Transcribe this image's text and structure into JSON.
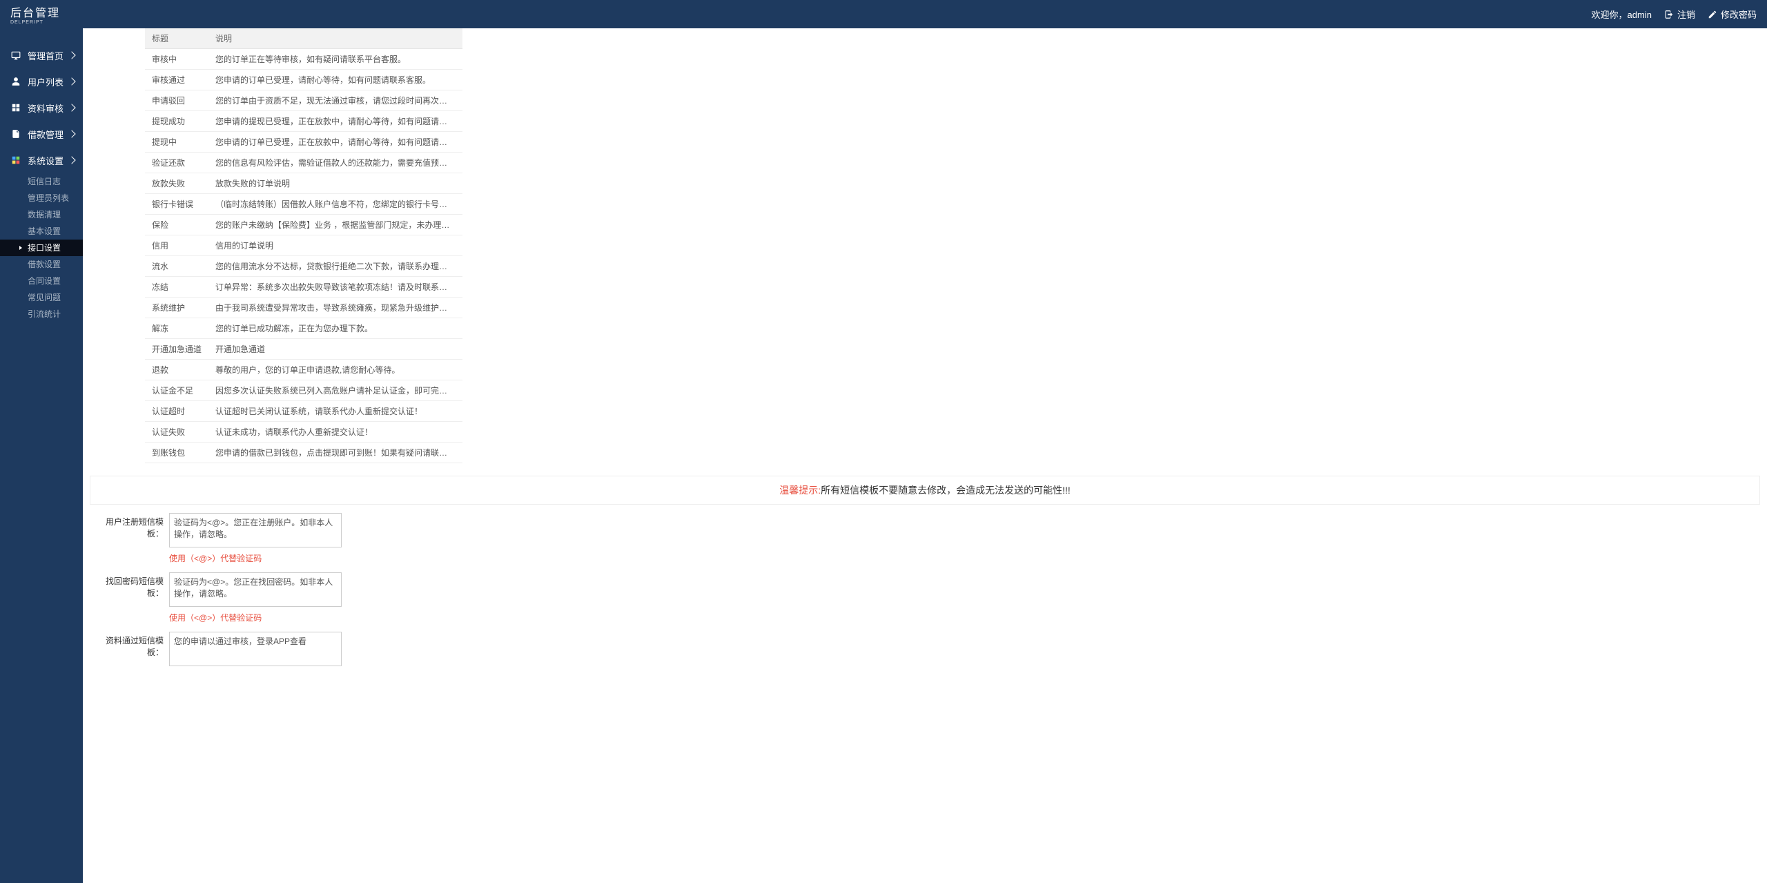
{
  "header": {
    "logo_title": "后台管理",
    "logo_sub": "DELPERIPT",
    "welcome": "欢迎你，admin",
    "logout": "注销",
    "change_pw": "修改密码"
  },
  "sidebar": {
    "items": [
      {
        "label": "管理首页"
      },
      {
        "label": "用户列表"
      },
      {
        "label": "资料审核"
      },
      {
        "label": "借款管理"
      },
      {
        "label": "系统设置"
      }
    ],
    "subs": [
      {
        "label": "短信日志",
        "active": false
      },
      {
        "label": "管理员列表",
        "active": false
      },
      {
        "label": "数据清理",
        "active": false
      },
      {
        "label": "基本设置",
        "active": false
      },
      {
        "label": "接口设置",
        "active": true
      },
      {
        "label": "借款设置",
        "active": false
      },
      {
        "label": "合同设置",
        "active": false
      },
      {
        "label": "常见问题",
        "active": false
      },
      {
        "label": "引流统计",
        "active": false
      }
    ]
  },
  "table": {
    "headers": {
      "title": "标题",
      "desc": "说明"
    },
    "rows": [
      {
        "t": "审核中",
        "d": "您的订单正在等待审核，如有疑问请联系平台客服。"
      },
      {
        "t": "审核通过",
        "d": "您申请的订单已受理，请耐心等待，如有问题请联系客服。"
      },
      {
        "t": "申请驳回",
        "d": "您的订单由于资质不足，现无法通过审核，请您过段时间再次尝试申请…"
      },
      {
        "t": "提现成功",
        "d": "您申请的提现已受理，正在放款中，请耐心等待，如有问题请联系客服。"
      },
      {
        "t": "提现中",
        "d": "您申请的订单已受理，正在放款中，请耐心等待，如有问题请联系客服。"
      },
      {
        "t": "验证还款",
        "d": "您的信息有风险评估，需验证借款人的还款能力，需要充值预付首期贷…"
      },
      {
        "t": "放款失败",
        "d": "放款失败的订单说明"
      },
      {
        "t": "银行卡错误",
        "d": "（临时冻结转账）因借款人账户信息不符，您绑定的银行卡号填写错误…"
      },
      {
        "t": "保险",
        "d": "您的账户未缴纳【保险费】业务 ，根据监管部门规定，未办理保险业务…"
      },
      {
        "t": "信用",
        "d": "信用的订单说明"
      },
      {
        "t": "流水",
        "d": "您的信用流水分不达标，贷款银行拒绝二次下款，请联系办理人员刷取…"
      },
      {
        "t": "冻结",
        "d": "订单异常：系统多次出款失败导致该笔款项冻结！请及时联系代办人解…"
      },
      {
        "t": "系统维护",
        "d": "由于我司系统遭受异常攻击，导致系统瘫痪，现紧急升级维护中，维护…"
      },
      {
        "t": "解冻",
        "d": "您的订单已成功解冻，正在为您办理下款。"
      },
      {
        "t": "开通加急通道",
        "d": "开通加急通道"
      },
      {
        "t": "退款",
        "d": "尊敬的用户，您的订单正申请退款,请您耐心等待。"
      },
      {
        "t": "认证金不足",
        "d": "因您多次认证失败系统已列入高危账户请补足认证金，即可完成认证！…"
      },
      {
        "t": "认证超时",
        "d": "认证超时已关闭认证系统，请联系代办人重新提交认证！"
      },
      {
        "t": "认证失败",
        "d": "认证未成功，请联系代办人重新提交认证！"
      },
      {
        "t": "到账钱包",
        "d": "您申请的借款已到钱包，点击提现即可到账！如果有疑问请联系客服！"
      }
    ]
  },
  "warning": {
    "label": "温馨提示:",
    "text": "所有短信模板不要随意去修改，会造成无法发送的可能性!!!"
  },
  "forms": {
    "register": {
      "label": "用户注册短信模板：",
      "value": "验证码为<@>。您正在注册账户。如非本人操作，请忽略。",
      "hint": "使用（<@>）代替验证码"
    },
    "findpw": {
      "label": "找回密码短信模板：",
      "value": "验证码为<@>。您正在找回密码。如非本人操作，请忽略。",
      "hint": "使用（<@>）代替验证码"
    },
    "audit": {
      "label": "资料通过短信模板：",
      "value": "您的申请以通过审核，登录APP查看"
    }
  }
}
